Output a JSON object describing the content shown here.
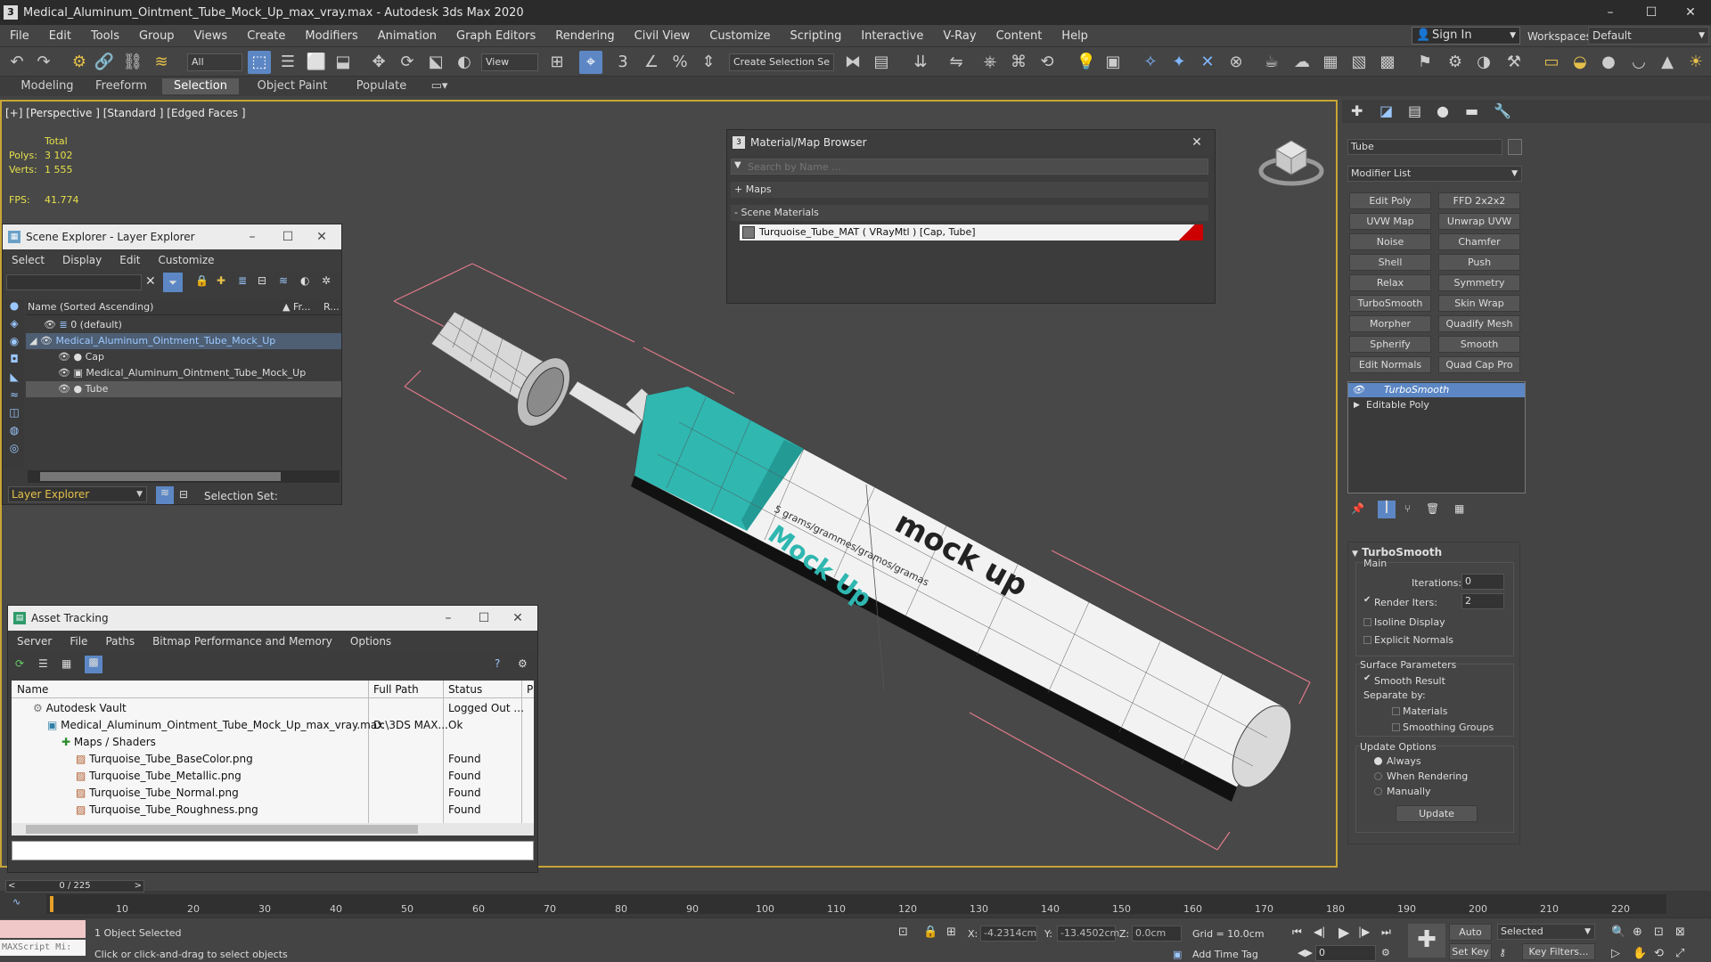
{
  "app": {
    "title": "Medical_Aluminum_Ointment_Tube_Mock_Up_max_vray.max - Autodesk 3ds Max 2020",
    "logo_char": "3"
  },
  "menubar": {
    "items": [
      "File",
      "Edit",
      "Tools",
      "Group",
      "Views",
      "Create",
      "Modifiers",
      "Animation",
      "Graph Editors",
      "Rendering",
      "Civil View",
      "Customize",
      "Scripting",
      "Interactive",
      "V-Ray",
      "Content",
      "Help"
    ]
  },
  "account": {
    "signin": "Sign In",
    "workspaces_label": "Workspaces:",
    "workspace": "Default"
  },
  "toolbar": {
    "filter": "All",
    "refcoord": "View",
    "selset": "Create Selection Se"
  },
  "ribbon": {
    "tabs": [
      "Modeling",
      "Freeform",
      "Selection",
      "Object Paint",
      "Populate"
    ]
  },
  "viewport": {
    "label": "[+] [Perspective ] [Standard ] [Edged Faces ]",
    "stats": {
      "total": "Total",
      "polys_label": "Polys:",
      "polys": "3 102",
      "verts_label": "Verts:",
      "verts": "1 555",
      "fps_label": "FPS:",
      "fps": "41.774"
    },
    "tube_text": {
      "mock_up_bold": "mock up",
      "mock_up_teal": "Mock Up",
      "grams": "5 grams/grammes/gramos/gramas"
    }
  },
  "scene_explorer": {
    "title": "Scene Explorer - Layer Explorer",
    "menu": [
      "Select",
      "Display",
      "Edit",
      "Customize"
    ],
    "columns": {
      "name": "Name (Sorted Ascending)",
      "fr": "▲ Fr...",
      "r": "R..."
    },
    "rows": [
      "0 (default)",
      "Medical_Aluminum_Ointment_Tube_Mock_Up",
      "Cap",
      "Medical_Aluminum_Ointment_Tube_Mock_Up",
      "Tube"
    ],
    "footer_dropdown": "Layer Explorer",
    "selection_set": "Selection Set:"
  },
  "material_browser": {
    "title": "Material/Map Browser",
    "search_placeholder": "Search by Name ...",
    "maps": "+ Maps",
    "scene_materials": "- Scene Materials",
    "material": "Turquoise_Tube_MAT ( VRayMtl ) [Cap, Tube]"
  },
  "asset_tracking": {
    "title": "Asset Tracking",
    "menu": [
      "Server",
      "File",
      "Paths",
      "Bitmap Performance and Memory",
      "Options"
    ],
    "columns": {
      "name": "Name",
      "path": "Full Path",
      "status": "Status",
      "p": "P"
    },
    "rows": [
      {
        "name": "Autodesk Vault",
        "path": "",
        "status": "Logged Out ..."
      },
      {
        "name": "Medical_Aluminum_Ointment_Tube_Mock_Up_max_vray.max",
        "path": "D:\\3DS MAX...",
        "status": "Ok"
      },
      {
        "name": "Maps / Shaders",
        "path": "",
        "status": ""
      },
      {
        "name": "Turquoise_Tube_BaseColor.png",
        "path": "",
        "status": "Found"
      },
      {
        "name": "Turquoise_Tube_Metallic.png",
        "path": "",
        "status": "Found"
      },
      {
        "name": "Turquoise_Tube_Normal.png",
        "path": "",
        "status": "Found"
      },
      {
        "name": "Turquoise_Tube_Roughness.png",
        "path": "",
        "status": "Found"
      }
    ]
  },
  "command_panel": {
    "object_name": "Tube",
    "modifier_list": "Modifier List",
    "modifiers": [
      "Edit Poly",
      "FFD 2x2x2",
      "UVW Map",
      "Unwrap UVW",
      "Noise",
      "Chamfer",
      "Shell",
      "Push",
      "Relax",
      "Symmetry",
      "TurboSmooth",
      "Skin Wrap",
      "Morpher",
      "Quadify Mesh",
      "Spherify",
      "Smooth",
      "Edit Normals",
      "Quad Cap Pro"
    ],
    "stack": [
      "TurboSmooth",
      "Editable Poly"
    ],
    "rollout": {
      "title": "TurboSmooth",
      "main": "Main",
      "iterations_label": "Iterations:",
      "iterations": "0",
      "render_iters_label": "Render Iters:",
      "render_iters": "2",
      "isoline": "Isoline Display",
      "explicit": "Explicit Normals",
      "surface": "Surface Parameters",
      "smooth_result": "Smooth Result",
      "separate_by": "Separate by:",
      "materials": "Materials",
      "smoothing_groups": "Smoothing Groups",
      "update_options": "Update Options",
      "always": "Always",
      "when_rendering": "When Rendering",
      "manually": "Manually",
      "update": "Update"
    }
  },
  "timeline": {
    "frame": "0 / 225",
    "ticks": [
      "10",
      "20",
      "30",
      "40",
      "50",
      "60",
      "70",
      "80",
      "90",
      "100",
      "110",
      "120",
      "130",
      "140",
      "150",
      "160",
      "170",
      "180",
      "190",
      "200",
      "210",
      "220"
    ]
  },
  "status": {
    "maxscript": "MAXScript Mi:",
    "selected": "1 Object Selected",
    "prompt": "Click or click-and-drag to select objects",
    "x_label": "X:",
    "x": "-4.2314cm",
    "y_label": "Y:",
    "y": "-13.4502cm",
    "z_label": "Z:",
    "z": "0.0cm",
    "grid": "Grid = 10.0cm",
    "add_time_tag": "Add Time Tag",
    "auto_key": "Auto Key",
    "set_key": "Set Key",
    "selected_dd": "Selected",
    "key_filters": "Key Filters...",
    "frame_field": "0"
  }
}
